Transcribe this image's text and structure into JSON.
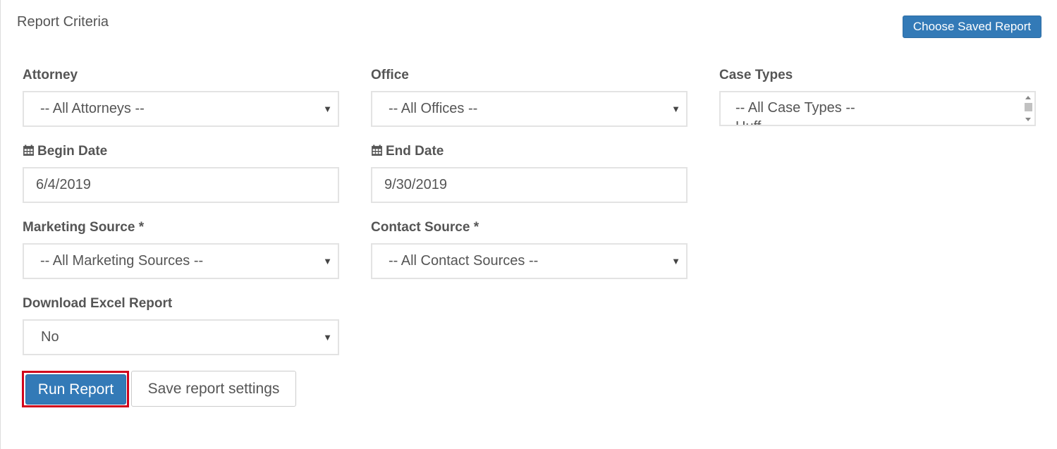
{
  "panel": {
    "title": "Report Criteria",
    "choose_saved_label": "Choose Saved Report"
  },
  "fields": {
    "attorney": {
      "label": "Attorney",
      "value": "-- All Attorneys --"
    },
    "office": {
      "label": "Office",
      "value": "-- All Offices --"
    },
    "case_types": {
      "label": "Case Types",
      "options": [
        "-- All Case Types --",
        "Huff"
      ]
    },
    "begin_date": {
      "label": "Begin Date",
      "value": "6/4/2019",
      "icon": "calendar-icon"
    },
    "end_date": {
      "label": "End Date",
      "value": "9/30/2019",
      "icon": "calendar-icon"
    },
    "marketing_source": {
      "label": "Marketing Source *",
      "value": "-- All Marketing Sources --"
    },
    "contact_source": {
      "label": "Contact Source *",
      "value": "-- All Contact Sources --"
    },
    "download_excel": {
      "label": "Download Excel Report",
      "value": "No"
    }
  },
  "actions": {
    "run_label": "Run Report",
    "save_label": "Save report settings"
  },
  "colors": {
    "primary": "#337ab7",
    "highlight_outline": "#d0021b",
    "text": "#555555"
  }
}
